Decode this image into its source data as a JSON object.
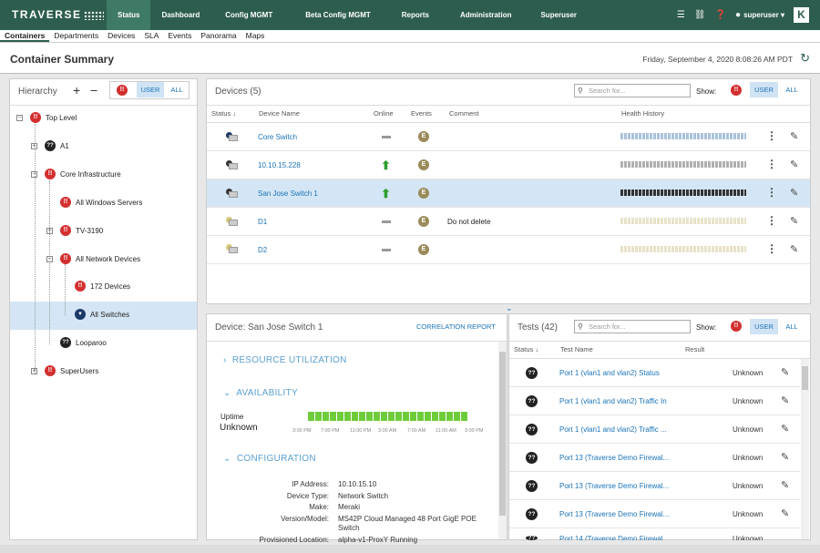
{
  "app": {
    "logo": "TRAVERSE",
    "nav": [
      "Status",
      "Dashboard",
      "Config MGMT",
      "Beta Config MGMT",
      "Reports",
      "Administration",
      "Superuser"
    ],
    "user": "superuser",
    "k_badge": "K"
  },
  "subnav": [
    "Containers",
    "Departments",
    "Devices",
    "SLA",
    "Events",
    "Panorama",
    "Maps"
  ],
  "page": {
    "title": "Container Summary",
    "datetime": "Friday, September 4, 2020 8:08:26 AM PDT"
  },
  "hierarchy": {
    "title": "Hierarchy",
    "add": "+",
    "remove": "−",
    "user_btn": "USER",
    "all_btn": "ALL",
    "nodes": {
      "top": "Top Level",
      "a1": "A1",
      "core": "Core Infrastructure",
      "win": "All Windows Servers",
      "tv": "TV-3190",
      "netdev": "All Network Devices",
      "d172": "172 Devices",
      "switches": "All Switches",
      "loop": "Looparoo",
      "superusers": "SuperUsers"
    },
    "badges": {
      "red": "!!",
      "unknown": "??"
    }
  },
  "devices": {
    "title": "Devices",
    "count": "(5)",
    "search_placeholder": "Search for...",
    "show_label": "Show:",
    "user_btn": "USER",
    "all_btn": "ALL",
    "columns": {
      "status": "Status",
      "name": "Device Name",
      "online": "Online",
      "events": "Events",
      "comment": "Comment",
      "health": "Health History"
    },
    "rows": [
      {
        "name": "Core Switch",
        "online": "dash",
        "comment": "",
        "health_color": "#a9c2dc"
      },
      {
        "name": "10.10.15.228",
        "online": "up",
        "comment": "",
        "health_color": "#b0b0b0"
      },
      {
        "name": "San Jose Switch 1",
        "online": "up",
        "comment": "",
        "health_color": "#333333"
      },
      {
        "name": "D1",
        "online": "dash",
        "comment": "Do not delete",
        "health_color": "#e8e2c8"
      },
      {
        "name": "D2",
        "online": "dash",
        "comment": "",
        "health_color": "#e8e2c8"
      }
    ],
    "event_badge": "E"
  },
  "detail": {
    "title": "Device: San Jose Switch 1",
    "correlation": "CORRELATION REPORT",
    "resource": "RESOURCE UTILIZATION",
    "availability": "AVAILABILITY",
    "uptime_label": "Uptime",
    "uptime_value": "Unknown",
    "ticks": [
      "3:00 PM",
      "7:00 PM",
      "11:00 PM",
      "3:00 AM",
      "7:00 AM",
      "11:00 AM",
      "3:00 PM"
    ],
    "configuration": "CONFIGURATION",
    "config": [
      {
        "label": "IP Address:",
        "value": "10.10.15.10"
      },
      {
        "label": "Device Type:",
        "value": "Network Switch"
      },
      {
        "label": "Make:",
        "value": "Meraki"
      },
      {
        "label": "Version/Model:",
        "value": "MS42P Cloud Managed 48 Port GigE POE"
      },
      {
        "label": "",
        "value": "Switch"
      },
      {
        "label": "Provisioned Location:",
        "value": "alpha-v1-ProxY Running"
      }
    ]
  },
  "tests": {
    "title": "Tests",
    "count": "(42)",
    "search_placeholder": "Search for...",
    "show_label": "Show:",
    "user_btn": "USER",
    "all_btn": "ALL",
    "columns": {
      "status": "Status",
      "name": "Test Name",
      "result": "Result"
    },
    "rows": [
      {
        "name": "Port 1 (vlan1 and vlan2) Status",
        "result": "Unknown"
      },
      {
        "name": "Port 1 (vlan1 and vlan2) Traffic In",
        "result": "Unknown"
      },
      {
        "name": "Port 1 (vlan1 and vlan2) Traffic ...",
        "result": "Unknown"
      },
      {
        "name": "Port 13 (Traverse Demo Firewal...",
        "result": "Unknown"
      },
      {
        "name": "Port 13 (Traverse Demo Firewal...",
        "result": "Unknown"
      },
      {
        "name": "Port 13 (Traverse Demo Firewal...",
        "result": "Unknown"
      },
      {
        "name": "Port 14 (Traverse Demo Firewal...",
        "result": "Unknown"
      }
    ],
    "badge": "??"
  },
  "colors": {
    "header": "#2d5d4e",
    "link": "#1a73b8",
    "selected": "#d4e6f5",
    "alert": "#d32f2f"
  }
}
